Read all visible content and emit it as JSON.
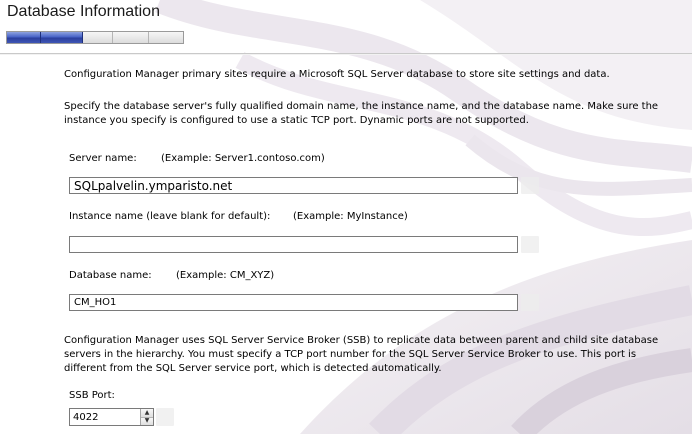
{
  "header": {
    "title": "Database Information",
    "progress": {
      "completed_steps": 2,
      "total_steps": 5
    }
  },
  "intro": {
    "line1": "Configuration Manager primary sites require a Microsoft SQL Server database to store site settings and data.",
    "line2": "Specify the database server's fully qualified domain name, the instance name, and the database name. Make sure the instance you specify is configured to use a static TCP port. Dynamic ports are not supported."
  },
  "server": {
    "label": "Server name:",
    "example": "(Example: Server1.contoso.com)",
    "value": "SQLpalvelin.ymparisto.net"
  },
  "instance": {
    "label": "Instance name (leave blank for default):",
    "example": "(Example: MyInstance)",
    "value": ""
  },
  "database": {
    "label": "Database name:",
    "example": "(Example: CM_XYZ)",
    "value": "CM_HO1"
  },
  "ssb": {
    "description": "Configuration Manager uses SQL Server Service Broker (SSB) to replicate data between parent and child site database servers in the hierarchy. You must specify a TCP port number for the SQL Server Service Broker to use. This port is different from the SQL Server service port, which is detected automatically.",
    "port_label": "SSB Port:",
    "port_value": "4022",
    "up_icon": "spin-up-arrow",
    "down_icon": "spin-down-arrow"
  },
  "colors": {
    "progress_fill": "#3f56b5",
    "field_border": "#7a7a7a"
  }
}
